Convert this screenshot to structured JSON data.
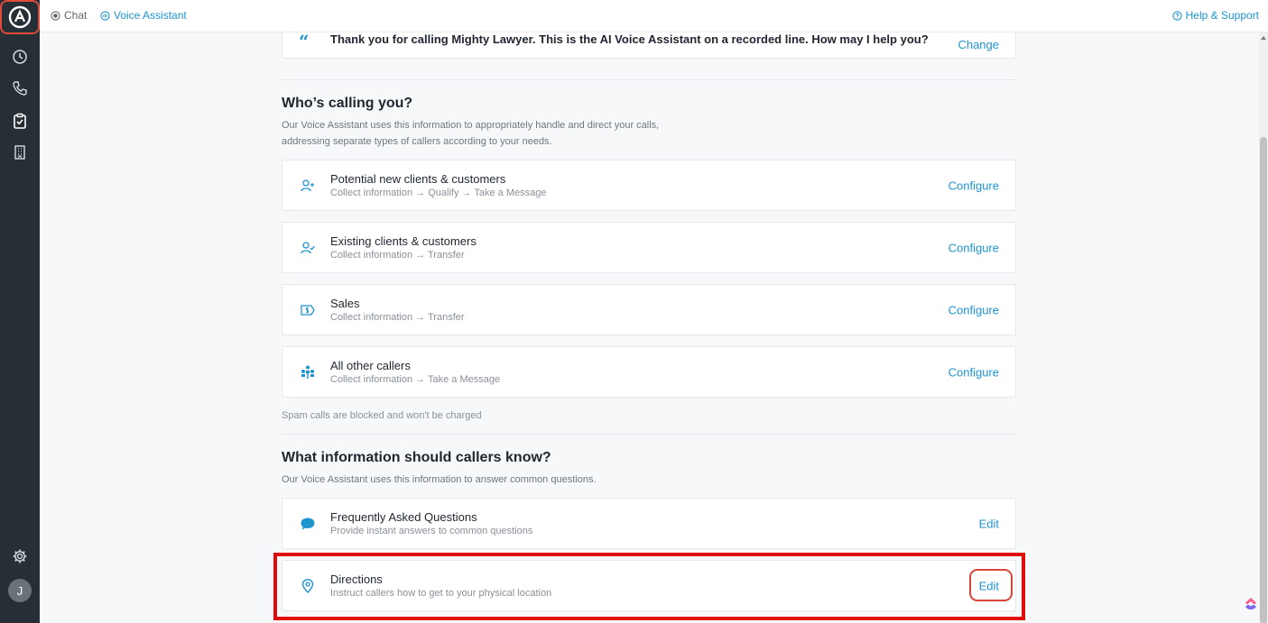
{
  "sidebar": {
    "items": [
      {
        "name": "logo-icon"
      },
      {
        "name": "history-icon"
      },
      {
        "name": "phone-icon"
      },
      {
        "name": "clipboard-check-icon",
        "active": true
      },
      {
        "name": "building-icon"
      },
      {
        "name": "gear-icon"
      }
    ],
    "avatar_initial": "J"
  },
  "topbar": {
    "chat_label": "Chat",
    "voice_assistant_label": "Voice Assistant",
    "help_label": "Help & Support"
  },
  "greeting": {
    "text": "Thank you for calling Mighty Lawyer. This is the AI Voice Assistant on a recorded line. How may I help you?",
    "action": "Change"
  },
  "callers_section": {
    "title": "Who’s calling you?",
    "description": "Our Voice Assistant uses this information to appropriately handle and direct your calls, addressing separate types of callers according to your needs.",
    "items": [
      {
        "title": "Potential new clients & customers",
        "sub": "Collect information → Qualify → Take a Message",
        "action": "Configure",
        "icon": "user-plus-icon"
      },
      {
        "title": "Existing clients & customers",
        "sub": "Collect information → Transfer",
        "action": "Configure",
        "icon": "user-check-icon"
      },
      {
        "title": "Sales",
        "sub": "Collect information → Transfer",
        "action": "Configure",
        "icon": "dollar-tag-icon"
      },
      {
        "title": "All other callers",
        "sub": "Collect information → Take a Message",
        "action": "Configure",
        "icon": "group-icon"
      }
    ],
    "note": "Spam calls are blocked and won't be charged"
  },
  "info_section": {
    "title": "What information should callers know?",
    "description": "Our Voice Assistant uses this information to answer common questions.",
    "items": [
      {
        "title": "Frequently Asked Questions",
        "sub": "Provide instant answers to common questions",
        "action": "Edit",
        "icon": "chat-bubble-icon"
      },
      {
        "title": "Directions",
        "sub": "Instruct callers how to get to your physical location",
        "action": "Edit",
        "icon": "map-pin-icon"
      }
    ]
  },
  "colors": {
    "accent": "#1e94cf",
    "sidebar": "#262e36",
    "highlight": "#e00b0b"
  }
}
